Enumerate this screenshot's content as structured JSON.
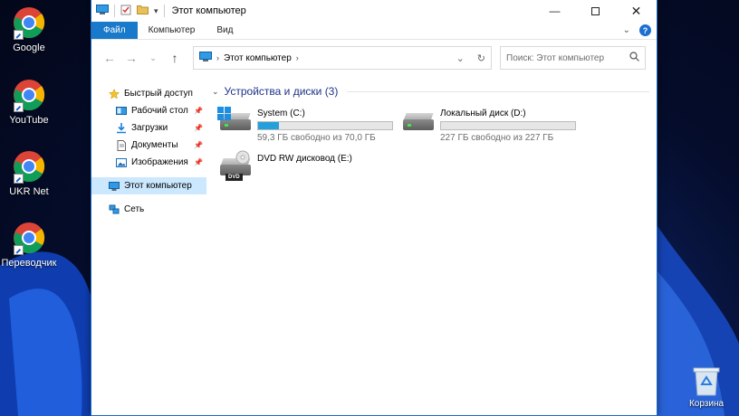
{
  "desktop": {
    "icons": [
      {
        "label": "Google",
        "icon": "chrome-icon"
      },
      {
        "label": "YouTube",
        "icon": "chrome-icon"
      },
      {
        "label": "UKR Net",
        "icon": "chrome-icon"
      },
      {
        "label": "Переводчик",
        "icon": "chrome-icon"
      }
    ],
    "recycle_bin": {
      "label": "Корзина",
      "icon": "recycle-bin-icon"
    }
  },
  "window": {
    "title": "Этот компьютер",
    "ribbon_tabs": [
      "Файл",
      "Компьютер",
      "Вид"
    ],
    "help_label": "?",
    "address": {
      "crumb": "Этот компьютер"
    },
    "search": {
      "placeholder": "Поиск: Этот компьютер"
    },
    "nav": {
      "quick_access": "Быстрый доступ",
      "quick_items": [
        "Рабочий стол",
        "Загрузки",
        "Документы",
        "Изображения"
      ],
      "this_pc": "Этот компьютер",
      "network": "Сеть"
    },
    "group": {
      "title": "Устройства и диски (3)"
    },
    "drives": [
      {
        "name": "System (C:)",
        "free_text": "59,3 ГБ свободно из 70,0 ГБ",
        "used_fraction": 0.153,
        "icon": "windows-drive-icon"
      },
      {
        "name": "Локальный диск (D:)",
        "free_text": "227 ГБ свободно из 227 ГБ",
        "used_fraction": 0.0,
        "icon": "hdd-icon"
      },
      {
        "name": "DVD RW дисковод (E:)",
        "icon": "dvd-drive-icon",
        "badge": "DVD"
      }
    ]
  },
  "colors": {
    "accent": "#1979ca",
    "bar_fill": "#26a0da",
    "group_header": "#1e3287",
    "selected": "#cce8ff"
  }
}
